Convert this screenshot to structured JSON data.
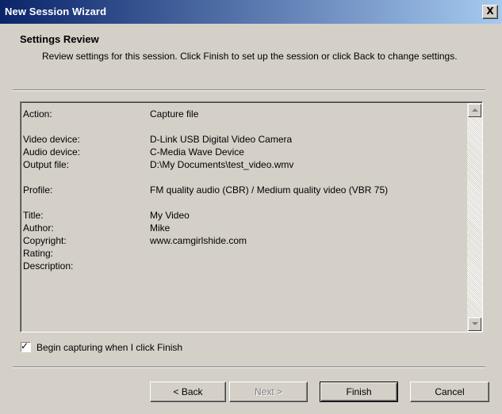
{
  "window": {
    "title": "New Session Wizard",
    "close_glyph": "X"
  },
  "header": {
    "title": "Settings Review",
    "description": "Review settings for this session. Click Finish to set up the session or click Back to change settings."
  },
  "settings": [
    {
      "key": "Action:",
      "value": "Capture file"
    },
    {
      "key": "Video device:",
      "value": "D-Link USB Digital Video Camera"
    },
    {
      "key": "Audio device:",
      "value": "C-Media Wave Device"
    },
    {
      "key": "Output file:",
      "value": "D:\\My Documents\\test_video.wmv"
    },
    {
      "key": "Profile:",
      "value": "FM quality audio (CBR) / Medium quality video (VBR 75)"
    },
    {
      "key": "Title:",
      "value": "My Video"
    },
    {
      "key": "Author:",
      "value": "Mike"
    },
    {
      "key": "Copyright:",
      "value": "www.camgirlshide.com"
    },
    {
      "key": "Rating:",
      "value": ""
    },
    {
      "key": "Description:",
      "value": ""
    }
  ],
  "checkbox": {
    "label": "Begin capturing when I click Finish",
    "checked": true
  },
  "buttons": {
    "back": "< Back",
    "next": "Next >",
    "finish": "Finish",
    "cancel": "Cancel"
  },
  "colors": {
    "title_bar_start": "#0a246a",
    "title_bar_end": "#a6caf0",
    "face": "#d4d0c8"
  },
  "icons": [
    "close-icon",
    "scroll-up-icon",
    "scroll-down-icon",
    "checkmark-icon"
  ]
}
